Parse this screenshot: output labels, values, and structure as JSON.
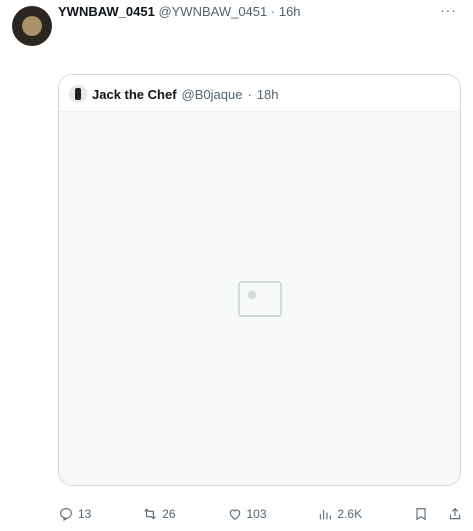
{
  "post": {
    "name": "YWNBAW_0451",
    "handle": "@YWNBAW_0451",
    "time": "16h",
    "more_icon": "more-icon",
    "body": ""
  },
  "quoted": {
    "name": "Jack the Chef",
    "handle": "@B0jaque",
    "time": "18h",
    "image_caption": ""
  },
  "actions": {
    "replies": "13",
    "reposts": "26",
    "likes": "103",
    "views": "2.6K"
  },
  "colors": {
    "muted_text": "#536471",
    "border": "#cfd9de"
  }
}
